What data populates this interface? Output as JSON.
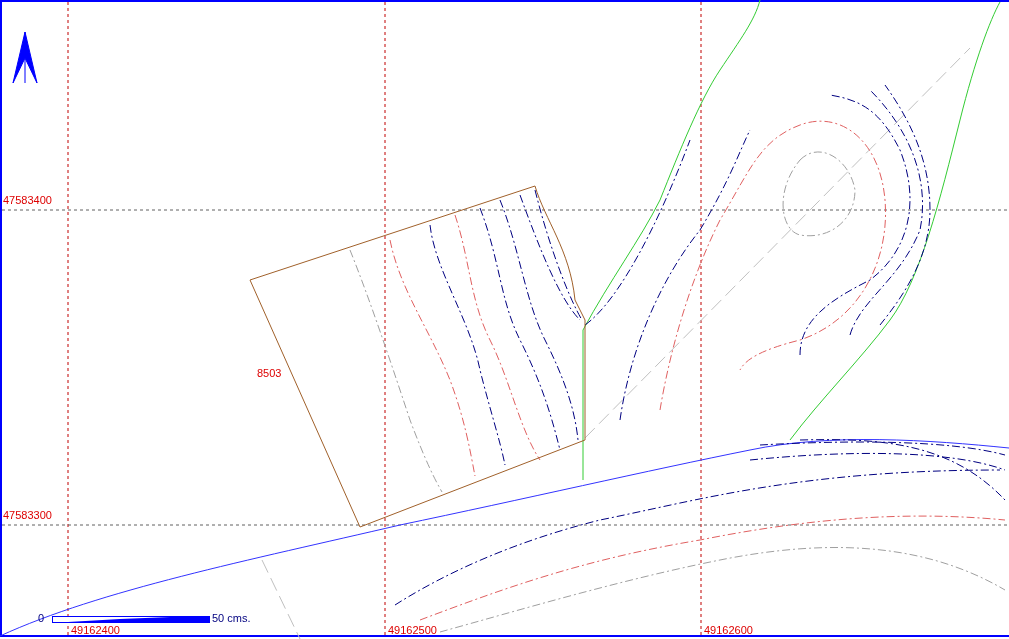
{
  "map": {
    "grid_x_labels": [
      "49162400",
      "49162500",
      "49162600"
    ],
    "grid_y_labels": [
      "47583400",
      "47583300"
    ],
    "parcel": {
      "label": "8503"
    },
    "scale_bar": {
      "start_label": "0",
      "end_label": "50 cms."
    }
  }
}
